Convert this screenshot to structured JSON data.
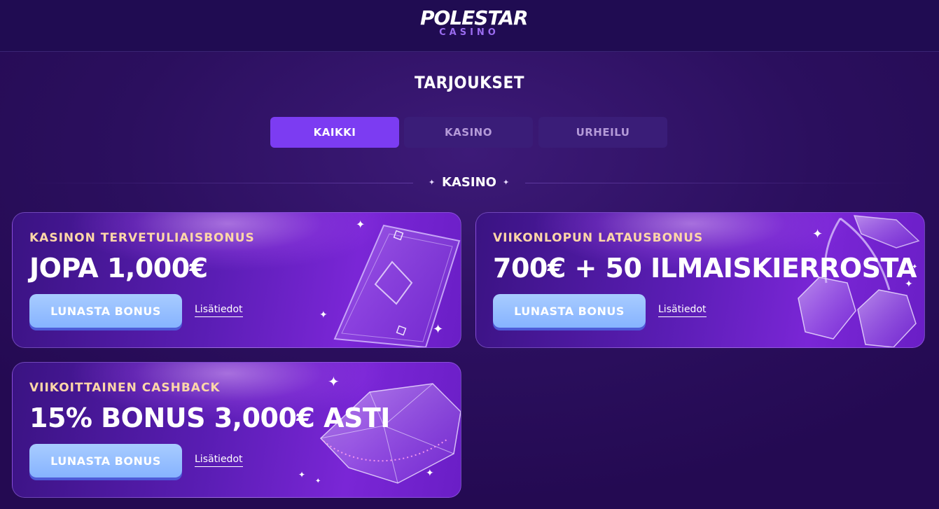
{
  "header": {
    "logo_main": "POLESTAR",
    "logo_sub": "CASINO"
  },
  "page": {
    "title": "TARJOUKSET"
  },
  "tabs": [
    {
      "label": "KAIKKI",
      "active": true
    },
    {
      "label": "KASINO",
      "active": false
    },
    {
      "label": "URHEILU",
      "active": false
    }
  ],
  "section": {
    "label": "KASINO"
  },
  "offers": [
    {
      "eyebrow": "KASINON TERVETULIAISBONUS",
      "headline": "JOPA 1,000€",
      "button": "LUNASTA BONUS",
      "link": "Lisätiedot",
      "art_icon": "playing-card-icon"
    },
    {
      "eyebrow": "VIIKONLOPUN LATAUSBONUS",
      "headline": "700€ + 50 ILMAISKIERROSTA",
      "button": "LUNASTA BONUS",
      "link": "Lisätiedot",
      "art_icon": "cherries-icon"
    },
    {
      "eyebrow": "VIIKOITTAINEN CASHBACK",
      "headline": "15% BONUS 3,000€ ASTI",
      "button": "LUNASTA BONUS",
      "link": "Lisätiedot",
      "art_icon": "diamond-icon"
    }
  ],
  "colors": {
    "background": "#2b0f5e",
    "header_bar": "#200c52",
    "tab_active": "#7c3cf2",
    "tab_inactive": "#3a1d78",
    "eyebrow": "#ffd7a8",
    "button": "#a8ccff",
    "logo_accent": "#9a6cf0"
  }
}
